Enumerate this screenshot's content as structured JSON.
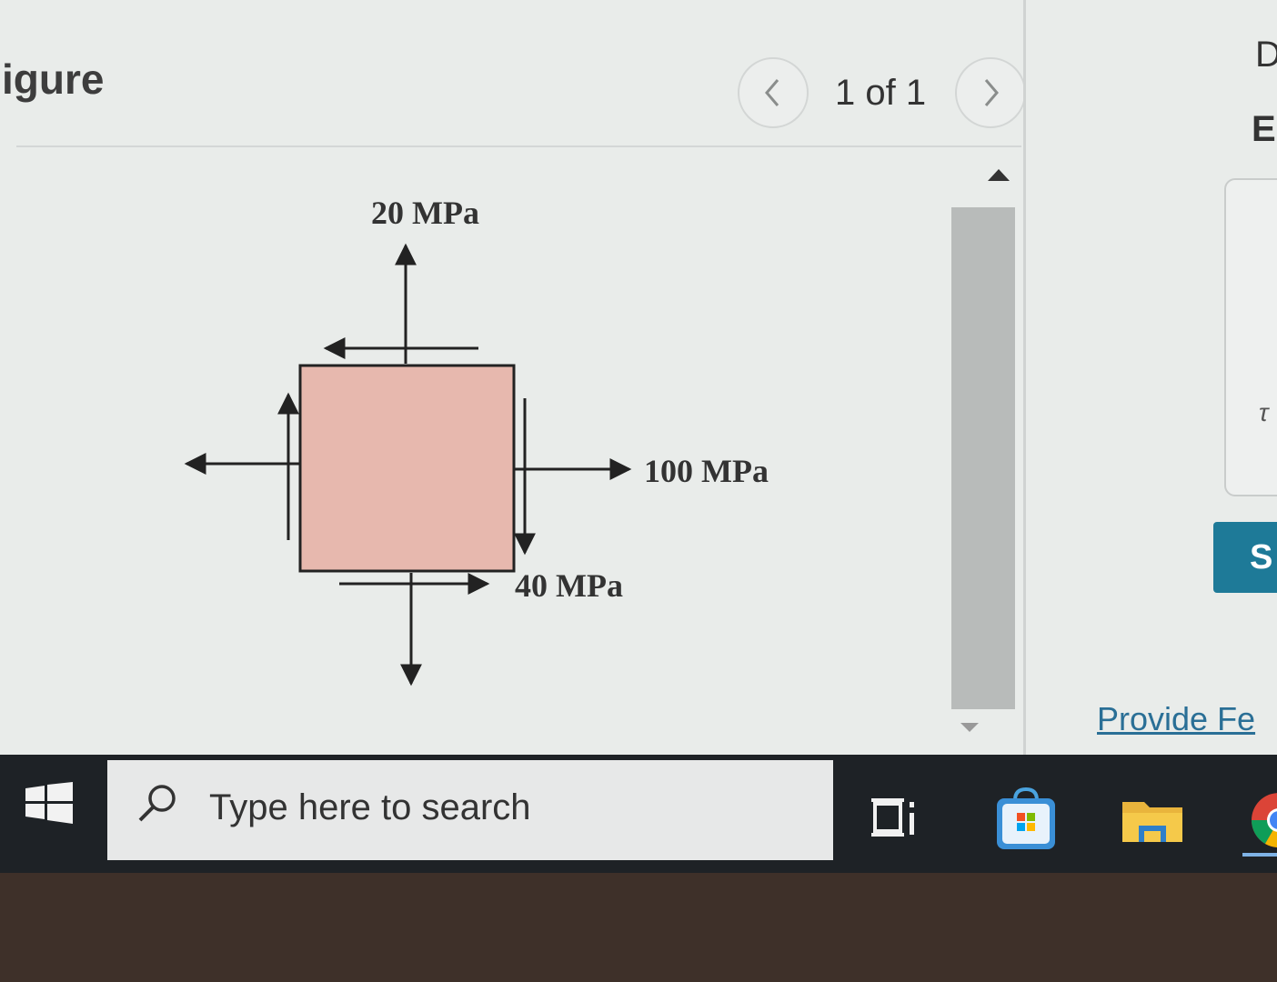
{
  "header": {
    "title": "igure",
    "page_indicator": "1 of 1"
  },
  "figure": {
    "labels": {
      "top_stress": "20 MPa",
      "right_stress": "100 MPa",
      "shear_stress": "40 MPa"
    },
    "element_color": "#e7b8ae"
  },
  "right_panel": {
    "partial_letter_d": "D",
    "partial_letter_e": "E",
    "partial_symbol": "τ",
    "submit_label": "S",
    "feedback_link": "Provide Fe"
  },
  "taskbar": {
    "search_placeholder": "Type here to search"
  },
  "colors": {
    "submit": "#1e7a98",
    "link": "#2a6f96",
    "taskbar": "#1e2226"
  }
}
